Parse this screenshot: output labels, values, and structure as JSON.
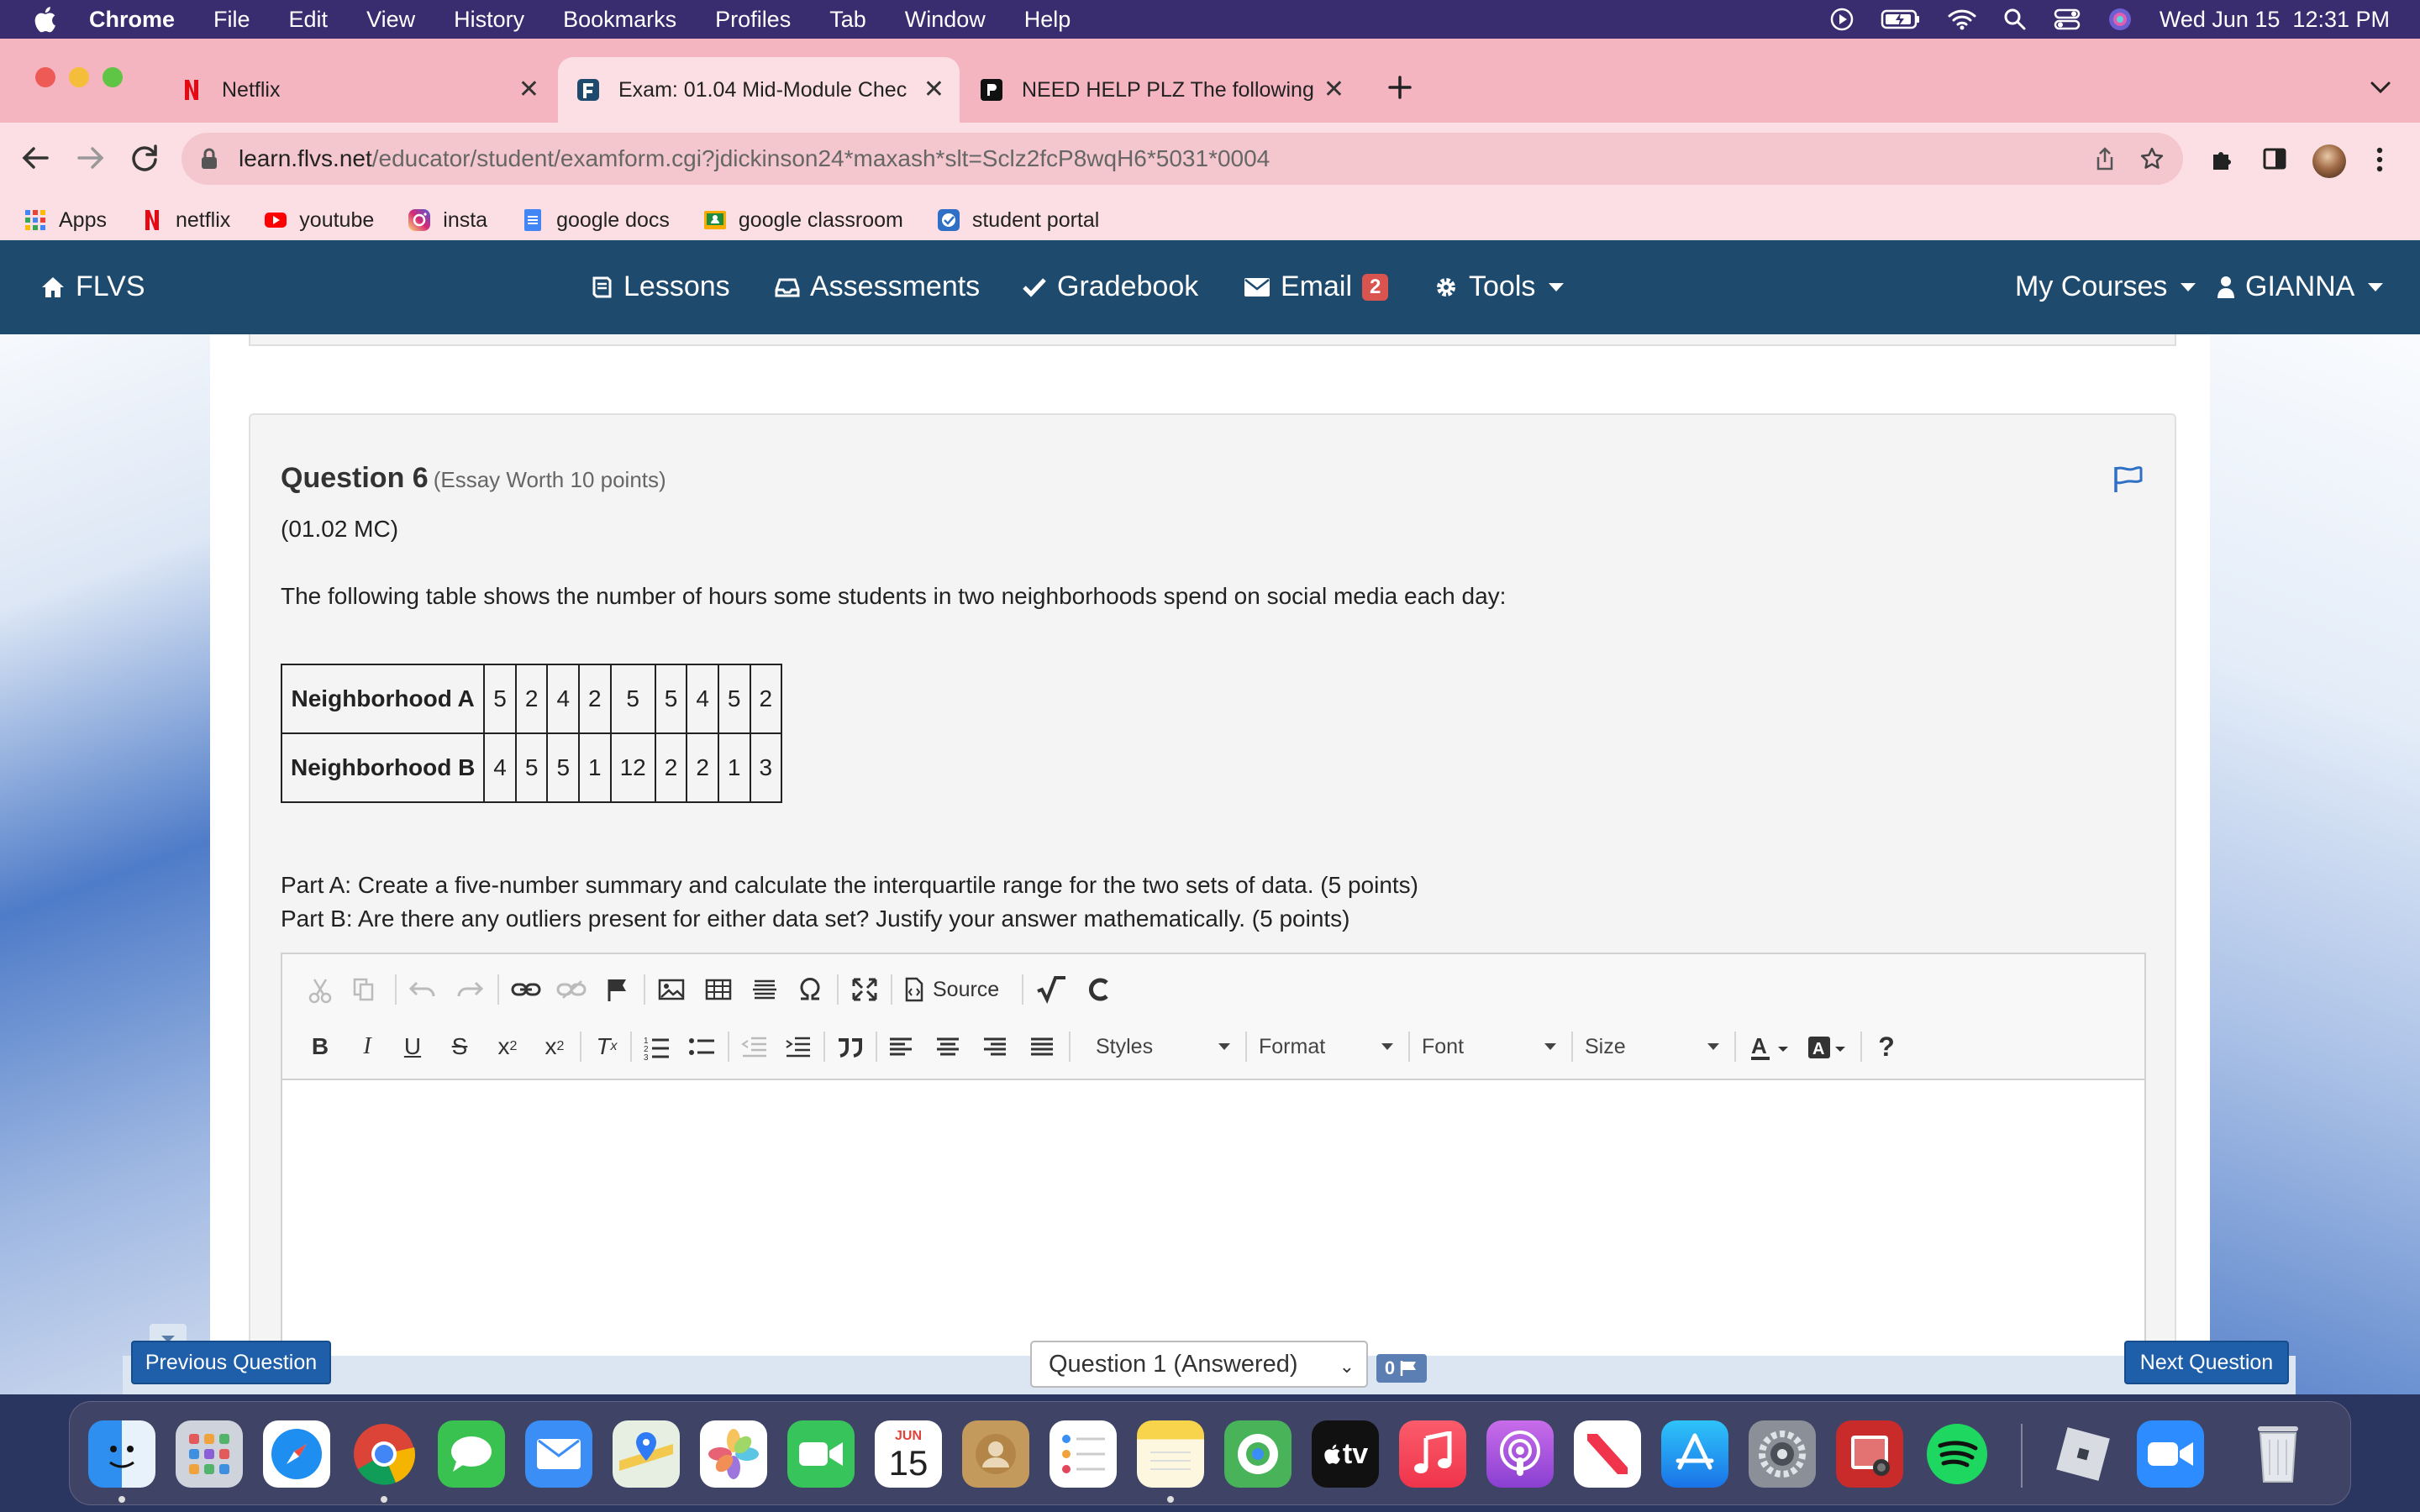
{
  "menubar": {
    "app": "Chrome",
    "items": [
      "File",
      "Edit",
      "View",
      "History",
      "Bookmarks",
      "Profiles",
      "Tab",
      "Window",
      "Help"
    ],
    "clock": "Wed Jun 15  12:31 PM"
  },
  "tabs": [
    {
      "label": "Netflix",
      "icon": "netflix-icon"
    },
    {
      "label": "Exam: 01.04 Mid-Module Chec",
      "icon": "flvs-icon",
      "active": true
    },
    {
      "label": "NEED HELP PLZ The following",
      "icon": "brainly-icon"
    }
  ],
  "address": {
    "host": "learn.flvs.net",
    "path": "/educator/student/examform.cgi?jdickinson24*maxash*slt=Sclz2fcP8wqH6*5031*0004"
  },
  "bookmarks": [
    {
      "label": "Apps",
      "icon": "apps-grid-icon"
    },
    {
      "label": "netflix",
      "icon": "netflix-icon"
    },
    {
      "label": "youtube",
      "icon": "youtube-icon"
    },
    {
      "label": "insta",
      "icon": "instagram-icon"
    },
    {
      "label": "google docs",
      "icon": "google-docs-icon"
    },
    {
      "label": "google classroom",
      "icon": "google-classroom-icon"
    },
    {
      "label": "student portal",
      "icon": "student-portal-icon"
    }
  ],
  "flvs_nav": {
    "brand": "FLVS",
    "lessons": "Lessons",
    "assessments": "Assessments",
    "gradebook": "Gradebook",
    "email": "Email",
    "email_count": "2",
    "tools": "Tools",
    "my_courses": "My Courses",
    "user": "GIANNA"
  },
  "question": {
    "title": "Question 6",
    "subtitle": "(Essay Worth 10 points)",
    "code": "(01.02 MC)",
    "text": "The following table shows the number of hours some students in two neighborhoods spend on social media each day:",
    "table": {
      "rows": [
        {
          "label": "Neighborhood A",
          "values": [
            "5",
            "2",
            "4",
            "2",
            "5",
            "5",
            "4",
            "5",
            "2"
          ]
        },
        {
          "label": "Neighborhood B",
          "values": [
            "4",
            "5",
            "5",
            "1",
            "12",
            "2",
            "2",
            "1",
            "3"
          ]
        }
      ]
    },
    "part_a": "Part A: Create a five-number summary and calculate the interquartile range for the two sets of data. (5 points)",
    "part_b": "Part B: Are there any outliers present for either data set? Justify your answer mathematically. (5 points)"
  },
  "editor": {
    "source_label": "Source",
    "styles_label": "Styles",
    "format_label": "Format",
    "font_label": "Font",
    "size_label": "Size",
    "help_label": "?"
  },
  "footer": {
    "prev": "Previous Question",
    "select_value": "Question 1 (Answered)",
    "flag_count": "0",
    "next": "Next Question"
  },
  "dock": {
    "calendar_month": "JUN",
    "calendar_day": "15",
    "tv_label": "tv"
  }
}
